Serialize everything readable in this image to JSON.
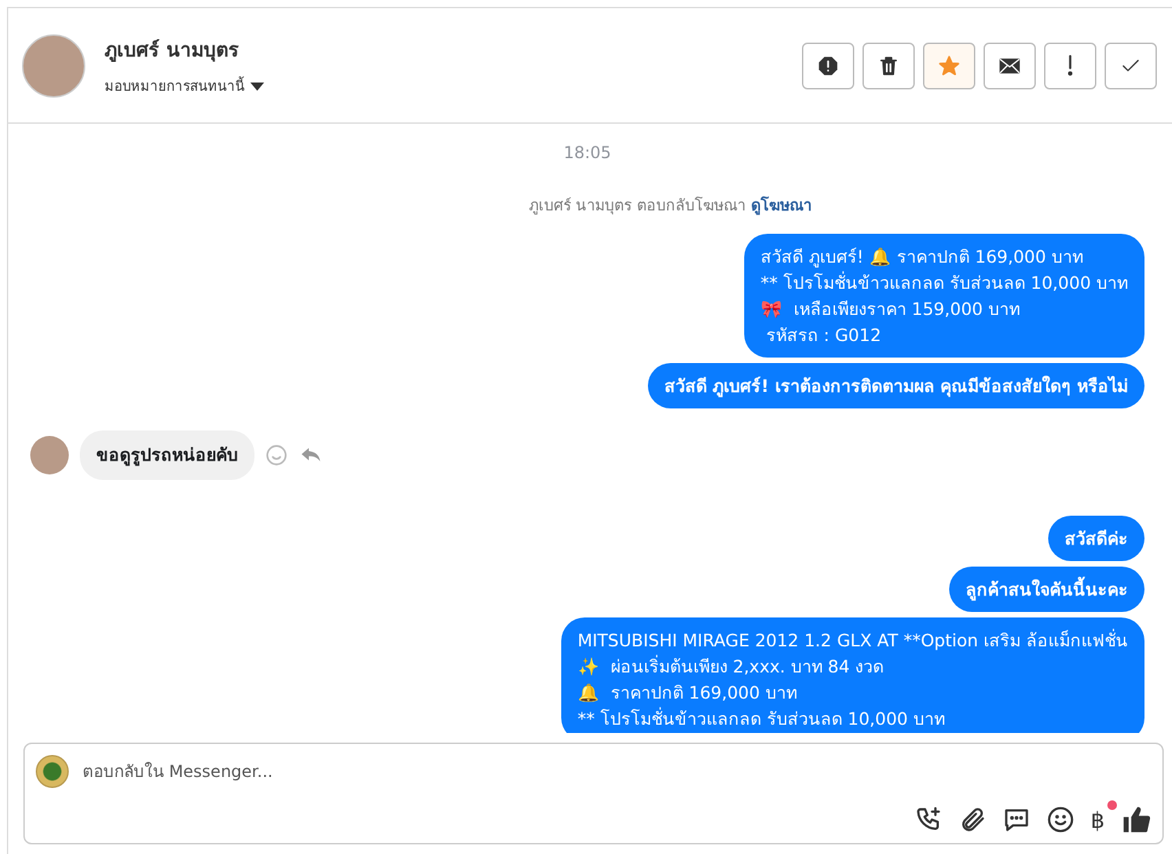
{
  "header": {
    "name": "ภูเบศร์ นามบุตร",
    "assign_label": "มอบหมายการสนทนานี้",
    "actions": [
      {
        "kind": "alert",
        "selected": false
      },
      {
        "kind": "trash",
        "selected": false
      },
      {
        "kind": "star",
        "selected": true
      },
      {
        "kind": "mail",
        "selected": false
      },
      {
        "kind": "exclaim",
        "selected": false
      },
      {
        "kind": "check",
        "selected": false
      }
    ]
  },
  "conversation": {
    "time": "18:05",
    "notice": "ภูเบศร์ นามบุตร ตอบกลับโฆษณา",
    "notice_link": "ดูโฆษณา",
    "messages": [
      {
        "kind": "out",
        "lines": [
          "สวัสดี ภูเบศร์! 🔔 ราคาปกติ 169,000 บาท",
          "** โปรโมชั่นข้าวแลกลด รับส่วนลด 10,000 บาท",
          "🎀  เหลือเพียงราคา 159,000 บาท",
          " รหัสรถ : G012"
        ],
        "bold": false
      },
      {
        "kind": "out",
        "lines": [
          "สวัสดี ภูเบศร์! เราต้องการติดตามผล คุณมีข้อสงสัยใดๆ หรือไม่"
        ],
        "bold": true
      },
      {
        "kind": "in",
        "lines": [
          "ขอดูรูปรถหน่อยคับ"
        ],
        "bold": true
      },
      {
        "kind": "out",
        "lines": [
          "สวัสดีค่ะ"
        ],
        "bold": true
      },
      {
        "kind": "out",
        "lines": [
          "ลูกค้าสนใจคันนี้นะคะ"
        ],
        "bold": true
      },
      {
        "kind": "out",
        "lines": [
          "MITSUBISHI MIRAGE 2012 1.2 GLX AT **Option เสริม ล้อแม็กแฟชั่น",
          "✨  ผ่อนเริ่มต้นเพียง 2,xxx. บาท 84 งวด",
          "🔔  ราคาปกติ 169,000 บาท",
          "** โปรโมชั่นข้าวแลกลด รับส่วนลด 10,000 บาท"
        ],
        "bold": false
      }
    ]
  },
  "composer": {
    "placeholder": "ตอบกลับใน Messenger...",
    "tools": [
      {
        "kind": "call"
      },
      {
        "kind": "attach"
      },
      {
        "kind": "chat"
      },
      {
        "kind": "emoji"
      },
      {
        "kind": "currency",
        "glyph": "฿",
        "has_notification": true
      },
      {
        "kind": "like"
      }
    ]
  }
}
